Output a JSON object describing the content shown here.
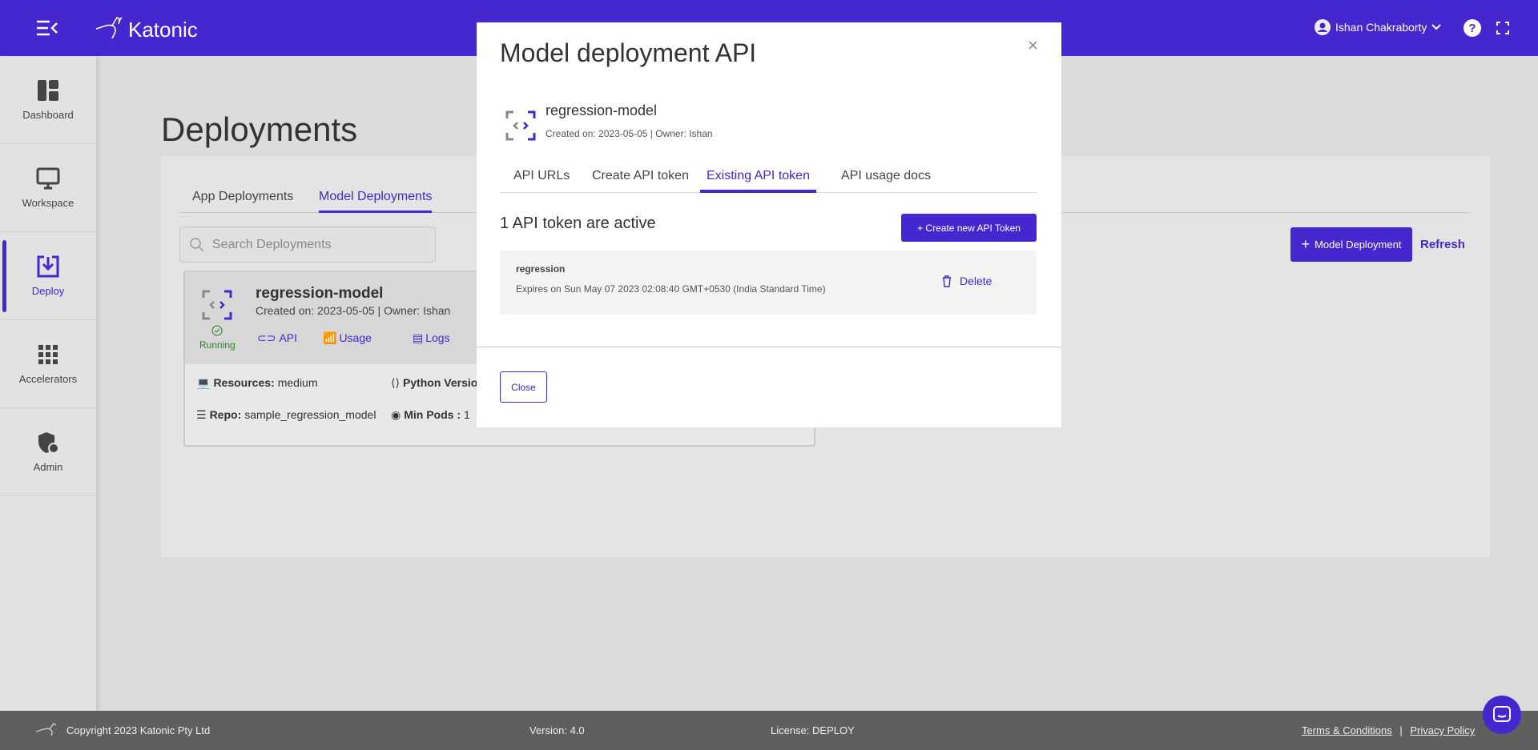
{
  "topbar": {
    "brand": "Katonic",
    "user": "Ishan Chakraborty",
    "menu_icon": "menu-collapse-icon",
    "help_icon": "help-icon",
    "fullscreen_icon": "fullscreen-icon"
  },
  "sidebar": {
    "items": [
      {
        "label": "Dashboard",
        "icon": "dashboard-icon"
      },
      {
        "label": "Workspace",
        "icon": "monitor-icon"
      },
      {
        "label": "Deploy",
        "icon": "deploy-icon",
        "active": true
      },
      {
        "label": "Accelerators",
        "icon": "grid-icon"
      },
      {
        "label": "Admin",
        "icon": "admin-shield-icon"
      }
    ]
  },
  "page": {
    "title": "Deployments",
    "tabs": [
      "App Deployments",
      "Model Deployments"
    ],
    "active_tab": "Model Deployments",
    "search_placeholder": "Search Deployments",
    "add_button": "Model Deployment",
    "refresh": "Refresh"
  },
  "card": {
    "name": "regression-model",
    "meta": "Created on: 2023-05-05 | Owner: Ishan",
    "status": "Running",
    "actions": [
      "API",
      "Usage",
      "Logs"
    ],
    "resources_label": "Resources:",
    "resources": "medium",
    "python_label": "Python Versio",
    "repo_label": "Repo:",
    "repo": "sample_regression_model",
    "pods_label": "Min Pods :",
    "pods": "1"
  },
  "modal": {
    "title": "Model deployment API",
    "close_x": "×",
    "model_name": "regression-model",
    "model_meta": "Created on: 2023-05-05 | Owner: Ishan",
    "tabs": [
      "API URLs",
      "Create API token",
      "Existing API token",
      "API usage docs"
    ],
    "active_tab": "Existing API token",
    "active_count": "1 API token are active",
    "create_button": "+ Create new API Token",
    "token": {
      "name": "regression",
      "expires": "Expires on Sun May 07 2023 02:08:40 GMT+0530 (India Standard Time)",
      "delete": "Delete"
    },
    "close_button": "Close"
  },
  "footer": {
    "copyright": "Copyright 2023 Katonic Pty Ltd",
    "version": "Version: 4.0",
    "license": "License: DEPLOY",
    "terms": "Terms & Conditions",
    "sep": "|",
    "privacy": "Privacy Policy"
  },
  "colors": {
    "accent": "#4527d0",
    "running": "#2e7d32"
  }
}
